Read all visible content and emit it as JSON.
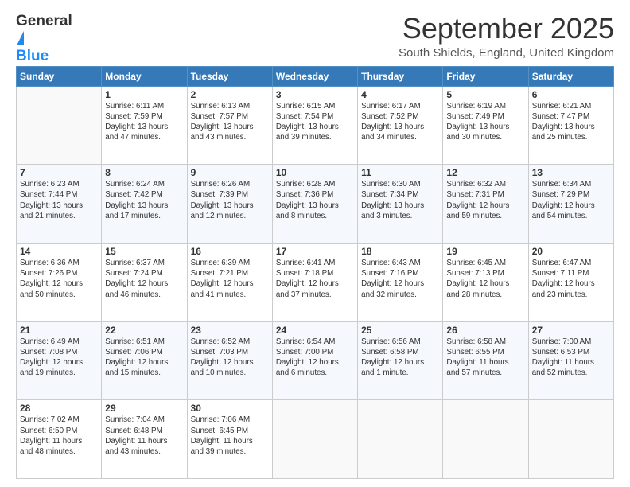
{
  "logo": {
    "line1": "General",
    "line2": "Blue"
  },
  "header": {
    "month": "September 2025",
    "location": "South Shields, England, United Kingdom"
  },
  "weekdays": [
    "Sunday",
    "Monday",
    "Tuesday",
    "Wednesday",
    "Thursday",
    "Friday",
    "Saturday"
  ],
  "weeks": [
    [
      {
        "day": "",
        "info": ""
      },
      {
        "day": "1",
        "info": "Sunrise: 6:11 AM\nSunset: 7:59 PM\nDaylight: 13 hours\nand 47 minutes."
      },
      {
        "day": "2",
        "info": "Sunrise: 6:13 AM\nSunset: 7:57 PM\nDaylight: 13 hours\nand 43 minutes."
      },
      {
        "day": "3",
        "info": "Sunrise: 6:15 AM\nSunset: 7:54 PM\nDaylight: 13 hours\nand 39 minutes."
      },
      {
        "day": "4",
        "info": "Sunrise: 6:17 AM\nSunset: 7:52 PM\nDaylight: 13 hours\nand 34 minutes."
      },
      {
        "day": "5",
        "info": "Sunrise: 6:19 AM\nSunset: 7:49 PM\nDaylight: 13 hours\nand 30 minutes."
      },
      {
        "day": "6",
        "info": "Sunrise: 6:21 AM\nSunset: 7:47 PM\nDaylight: 13 hours\nand 25 minutes."
      }
    ],
    [
      {
        "day": "7",
        "info": "Sunrise: 6:23 AM\nSunset: 7:44 PM\nDaylight: 13 hours\nand 21 minutes."
      },
      {
        "day": "8",
        "info": "Sunrise: 6:24 AM\nSunset: 7:42 PM\nDaylight: 13 hours\nand 17 minutes."
      },
      {
        "day": "9",
        "info": "Sunrise: 6:26 AM\nSunset: 7:39 PM\nDaylight: 13 hours\nand 12 minutes."
      },
      {
        "day": "10",
        "info": "Sunrise: 6:28 AM\nSunset: 7:36 PM\nDaylight: 13 hours\nand 8 minutes."
      },
      {
        "day": "11",
        "info": "Sunrise: 6:30 AM\nSunset: 7:34 PM\nDaylight: 13 hours\nand 3 minutes."
      },
      {
        "day": "12",
        "info": "Sunrise: 6:32 AM\nSunset: 7:31 PM\nDaylight: 12 hours\nand 59 minutes."
      },
      {
        "day": "13",
        "info": "Sunrise: 6:34 AM\nSunset: 7:29 PM\nDaylight: 12 hours\nand 54 minutes."
      }
    ],
    [
      {
        "day": "14",
        "info": "Sunrise: 6:36 AM\nSunset: 7:26 PM\nDaylight: 12 hours\nand 50 minutes."
      },
      {
        "day": "15",
        "info": "Sunrise: 6:37 AM\nSunset: 7:24 PM\nDaylight: 12 hours\nand 46 minutes."
      },
      {
        "day": "16",
        "info": "Sunrise: 6:39 AM\nSunset: 7:21 PM\nDaylight: 12 hours\nand 41 minutes."
      },
      {
        "day": "17",
        "info": "Sunrise: 6:41 AM\nSunset: 7:18 PM\nDaylight: 12 hours\nand 37 minutes."
      },
      {
        "day": "18",
        "info": "Sunrise: 6:43 AM\nSunset: 7:16 PM\nDaylight: 12 hours\nand 32 minutes."
      },
      {
        "day": "19",
        "info": "Sunrise: 6:45 AM\nSunset: 7:13 PM\nDaylight: 12 hours\nand 28 minutes."
      },
      {
        "day": "20",
        "info": "Sunrise: 6:47 AM\nSunset: 7:11 PM\nDaylight: 12 hours\nand 23 minutes."
      }
    ],
    [
      {
        "day": "21",
        "info": "Sunrise: 6:49 AM\nSunset: 7:08 PM\nDaylight: 12 hours\nand 19 minutes."
      },
      {
        "day": "22",
        "info": "Sunrise: 6:51 AM\nSunset: 7:06 PM\nDaylight: 12 hours\nand 15 minutes."
      },
      {
        "day": "23",
        "info": "Sunrise: 6:52 AM\nSunset: 7:03 PM\nDaylight: 12 hours\nand 10 minutes."
      },
      {
        "day": "24",
        "info": "Sunrise: 6:54 AM\nSunset: 7:00 PM\nDaylight: 12 hours\nand 6 minutes."
      },
      {
        "day": "25",
        "info": "Sunrise: 6:56 AM\nSunset: 6:58 PM\nDaylight: 12 hours\nand 1 minute."
      },
      {
        "day": "26",
        "info": "Sunrise: 6:58 AM\nSunset: 6:55 PM\nDaylight: 11 hours\nand 57 minutes."
      },
      {
        "day": "27",
        "info": "Sunrise: 7:00 AM\nSunset: 6:53 PM\nDaylight: 11 hours\nand 52 minutes."
      }
    ],
    [
      {
        "day": "28",
        "info": "Sunrise: 7:02 AM\nSunset: 6:50 PM\nDaylight: 11 hours\nand 48 minutes."
      },
      {
        "day": "29",
        "info": "Sunrise: 7:04 AM\nSunset: 6:48 PM\nDaylight: 11 hours\nand 43 minutes."
      },
      {
        "day": "30",
        "info": "Sunrise: 7:06 AM\nSunset: 6:45 PM\nDaylight: 11 hours\nand 39 minutes."
      },
      {
        "day": "",
        "info": ""
      },
      {
        "day": "",
        "info": ""
      },
      {
        "day": "",
        "info": ""
      },
      {
        "day": "",
        "info": ""
      }
    ]
  ]
}
